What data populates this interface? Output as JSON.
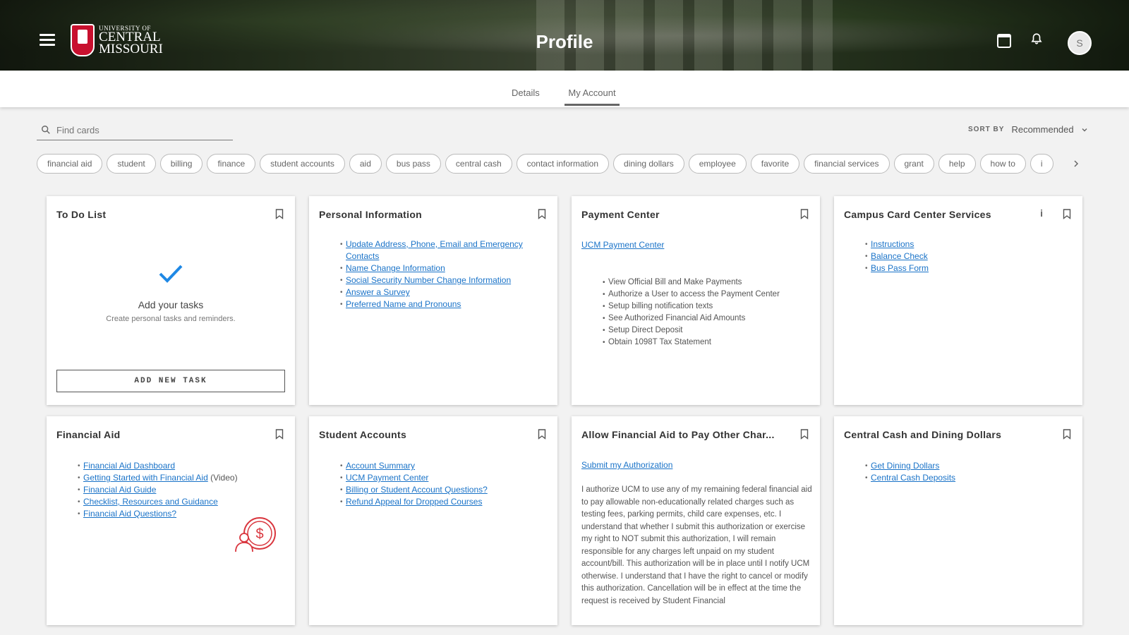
{
  "header": {
    "title": "Profile",
    "logo_line1": "UNIVERSITY OF",
    "logo_line2": "CENTRAL",
    "logo_line3": "MISSOURI",
    "avatar_initial": "S"
  },
  "tabs": [
    {
      "label": "Details"
    },
    {
      "label": "My Account",
      "active": true
    }
  ],
  "search": {
    "placeholder": "Find cards"
  },
  "sort": {
    "label": "SORT BY",
    "value": "Recommended"
  },
  "chips": [
    "financial aid",
    "student",
    "billing",
    "finance",
    "student accounts",
    "aid",
    "bus pass",
    "central cash",
    "contact information",
    "dining dollars",
    "employee",
    "favorite",
    "financial services",
    "grant",
    "help",
    "how to",
    "i"
  ],
  "cards": {
    "todo": {
      "title": "To Do List",
      "empty_title": "Add your tasks",
      "empty_sub": "Create personal tasks and reminders.",
      "button": "ADD NEW TASK"
    },
    "personal": {
      "title": "Personal Information",
      "links": [
        "Update Address, Phone, Email and Emergency Contacts",
        "Name Change Information",
        "Social Security Number Change Information",
        "Answer a Survey",
        "Preferred Name and Pronouns"
      ]
    },
    "payment": {
      "title": "Payment Center",
      "link": "UCM Payment Center",
      "items": [
        "View Official Bill and Make Payments",
        "Authorize a User to access the Payment Center",
        "Setup billing notification texts",
        "See Authorized Financial Aid Amounts",
        "Setup Direct Deposit",
        "Obtain 1098T Tax Statement"
      ]
    },
    "campus": {
      "title": "Campus Card Center Services",
      "info": "i",
      "links": [
        "Instructions",
        "Balance Check",
        "Bus Pass Form"
      ]
    },
    "finaid": {
      "title": "Financial Aid",
      "links": [
        "Financial Aid Dashboard",
        "Getting Started with Financial Aid",
        "Financial Aid Guide",
        "Checklist, Resources and Guidance",
        "Financial Aid Questions?"
      ],
      "video_suffix": "(Video)"
    },
    "student_accounts": {
      "title": "Student Accounts",
      "links": [
        "Account Summary",
        "UCM Payment Center",
        "Billing or Student Account Questions?",
        "Refund Appeal for Dropped Courses"
      ]
    },
    "allow": {
      "title": "Allow Financial Aid to Pay Other Char...",
      "link": "Submit my Authorization",
      "paragraph": "I authorize UCM to use any of my remaining federal financial aid to pay allowable non-educationally related charges such as testing fees, parking permits, child care expenses, etc. I understand that whether I submit this authorization or exercise my right to NOT submit this authorization, I will remain responsible for any charges left unpaid on my student account/bill. This authorization will be in place until I notify UCM otherwise. I understand that I have the right to cancel or modify this authorization. Cancellation will be in effect at the time the request is received by Student Financial"
    },
    "central": {
      "title": "Central Cash and Dining Dollars",
      "links": [
        "Get Dining Dollars",
        "Central Cash Deposits"
      ]
    }
  },
  "colors": {
    "link": "#1a73c8",
    "accent_check": "#1e88e5",
    "brand_red": "#c8102e"
  }
}
